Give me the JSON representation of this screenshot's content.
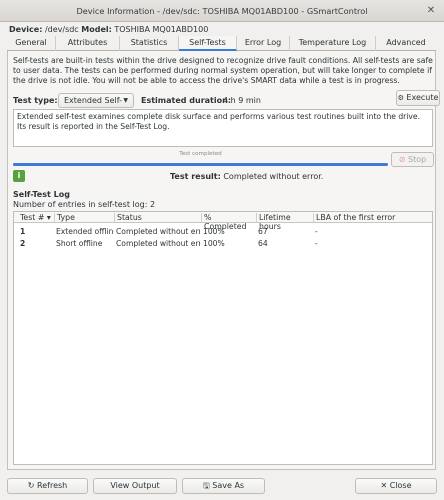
{
  "window": {
    "title": "Device Information - /dev/sdc: TOSHIBA MQ01ABD100 - GSmartControl",
    "close_glyph": "✕"
  },
  "device": {
    "device_label": "Device:",
    "device_value": "/dev/sdc",
    "model_label": "Model:",
    "model_value": "TOSHIBA MQ01ABD100"
  },
  "tabs": [
    {
      "label": "General"
    },
    {
      "label": "Attributes"
    },
    {
      "label": "Statistics"
    },
    {
      "label": "Self-Tests"
    },
    {
      "label": "Error Log"
    },
    {
      "label": "Temperature Log"
    },
    {
      "label": "Advanced"
    }
  ],
  "active_tab": "Self-Tests",
  "selftests": {
    "intro": "Self-tests are built-in tests within the drive designed to recognize drive fault conditions. All self-tests are safe to user data. The tests can be performed during normal system operation, but will take longer to complete if the drive is not idle. You will not be able to access the drive's SMART data while a test is in progress.",
    "test_type_label": "Test type:",
    "test_type_value": "Extended Self-test",
    "estimated_label": "Estimated duration:",
    "estimated_value": "4 h 9 min",
    "execute_label": "Execute",
    "description": "Extended self-test examines complete disk surface and performs various test routines built into the drive. Its result is reported in the Self-Test Log.",
    "progress_text": "Test completed",
    "progress_fraction": 1.0,
    "stop_label": "Stop",
    "result_label": "Test result:",
    "result_value": "Completed without error."
  },
  "log": {
    "title": "Self-Test Log",
    "count_text": "Number of entries in self-test log: 2",
    "columns": [
      "Test # ▾",
      "Type",
      "Status",
      "% Completed",
      "Lifetime hours",
      "LBA of the first error"
    ],
    "rows": [
      [
        "1",
        "Extended offline",
        "Completed without error",
        "100%",
        "67",
        "-"
      ],
      [
        "2",
        "Short offline",
        "Completed without error",
        "100%",
        "64",
        "-"
      ]
    ]
  },
  "buttons": {
    "refresh": "Refresh",
    "view_output": "View Output",
    "save_as": "Save As",
    "close": "Close"
  },
  "colors": {
    "accent": "#3d7bd4",
    "ok_green": "#57a13f",
    "stop_red": "#cc3a3a"
  }
}
